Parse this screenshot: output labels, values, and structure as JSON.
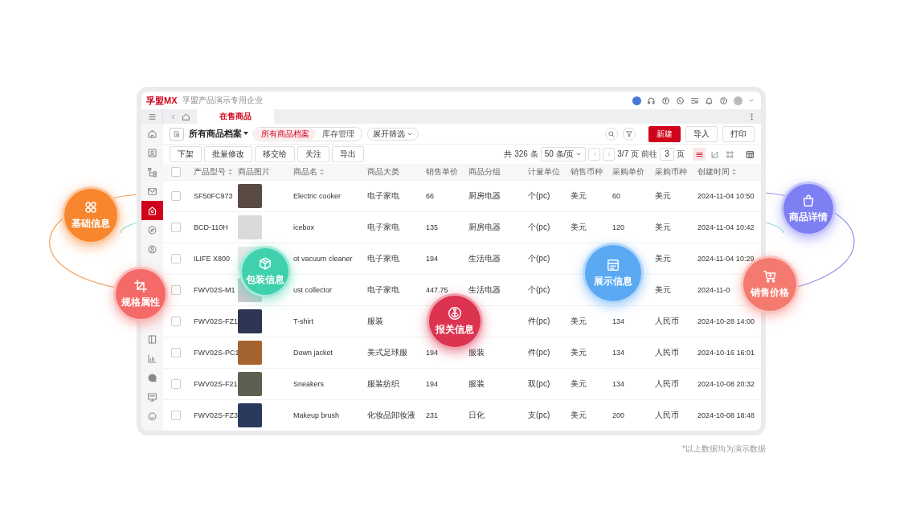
{
  "app": {
    "logo": "孚盟MX",
    "company": "孚盟产品演示专用企业"
  },
  "tabs": [
    {
      "label": "在售商品",
      "selected": true
    }
  ],
  "sidebar": {
    "items": [
      {
        "kind": "home",
        "selected": false
      },
      {
        "kind": "contact",
        "selected": false
      },
      {
        "kind": "org",
        "selected": false
      },
      {
        "kind": "mail",
        "selected": false
      },
      {
        "kind": "store",
        "selected": true
      },
      {
        "kind": "compass",
        "selected": false
      },
      {
        "kind": "user",
        "selected": false
      }
    ],
    "bottom_items": [
      {
        "kind": "book",
        "selected": false
      },
      {
        "kind": "chart",
        "selected": false
      },
      {
        "kind": "chat",
        "selected": false
      },
      {
        "kind": "monitor",
        "selected": false
      },
      {
        "kind": "smile",
        "selected": false
      }
    ]
  },
  "toolbar": {
    "title": "所有商品档案",
    "views": [
      {
        "label": "所有商品档案",
        "selected": true
      },
      {
        "label": "库存管理",
        "selected": false
      }
    ],
    "filter_toggle": "展开筛选",
    "new_button": "新建",
    "import_button": "导入",
    "print_button": "打印"
  },
  "actions": [
    "下架",
    "批量修改",
    "移交给",
    "关注",
    "导出"
  ],
  "pagination": {
    "total": "共 326 条",
    "page_size": "50 条/页",
    "page": "3/7 页",
    "goto_label": "前往",
    "goto_value": "3",
    "goto_unit": "页"
  },
  "view_modes": [
    {
      "kind": "list",
      "selected": true
    },
    {
      "kind": "chart",
      "selected": false
    },
    {
      "kind": "grid",
      "selected": false
    }
  ],
  "table": {
    "select_all": false,
    "columns": [
      {
        "label": "产品型号",
        "sortable": true
      },
      {
        "label": "商品图片",
        "sortable": false
      },
      {
        "label": "商品名",
        "sortable": true
      },
      {
        "label": "商品大类",
        "sortable": false
      },
      {
        "label": "销售单价",
        "sortable": false
      },
      {
        "label": "商品分组",
        "sortable": false
      },
      {
        "label": "计量单位",
        "sortable": false
      },
      {
        "label": "销售币种",
        "sortable": false
      },
      {
        "label": "采购单价",
        "sortable": false
      },
      {
        "label": "采购币种",
        "sortable": false
      },
      {
        "label": "创建时间",
        "sortable": true
      }
    ],
    "rows": [
      {
        "selected": false,
        "model": "SF50FC973",
        "name": "Electric cooker",
        "category": "电子家电",
        "price": "66",
        "group": "厨房电器",
        "unit": "个(pc)",
        "sale_currency": "美元",
        "purchase_price": "60",
        "purchase_currency": "美元",
        "created": "2024-11-04 10:50"
      },
      {
        "selected": false,
        "model": "BCD-110H",
        "name": "icebox",
        "category": "电子家电",
        "price": "135",
        "group": "厨房电器",
        "unit": "个(pc)",
        "sale_currency": "美元",
        "purchase_price": "120",
        "purchase_currency": "美元",
        "created": "2024-11-04 10:42"
      },
      {
        "selected": false,
        "model": "ILIFE X800",
        "name": "ot vacuum cleaner",
        "category": "电子家电",
        "price": "194",
        "group": "生活电器",
        "unit": "个(pc)",
        "purchase_currency": "美元",
        "created": "2024-11-04 10:29"
      },
      {
        "selected": false,
        "model": "FWV02S-M1",
        "name": "ust collector",
        "category": "电子家电",
        "price": "447.75",
        "group": "生活电器",
        "unit": "个(pc)",
        "purchase_currency": "美元",
        "created": "2024-11-0"
      },
      {
        "selected": false,
        "model": "FWV02S-FZ1",
        "name": "T-shirt",
        "category": "服装",
        "unit": "件(pc)",
        "sale_currency": "美元",
        "purchase_price": "134",
        "purchase_currency": "人民币",
        "created": "2024-10-28 14:00"
      },
      {
        "selected": false,
        "model": "FWV02S-PC1",
        "name": "Down jacket",
        "category": "美式足球服",
        "price": "194",
        "group": "服装",
        "unit": "件(pc)",
        "sale_currency": "美元",
        "purchase_price": "134",
        "purchase_currency": "人民币",
        "created": "2024-10-16 16:01"
      },
      {
        "selected": false,
        "model": "FWV02S-F21",
        "name": "Sneakers",
        "category": "服装纺织",
        "price": "194",
        "group": "服装",
        "unit": "双(pc)",
        "sale_currency": "美元",
        "purchase_price": "134",
        "purchase_currency": "人民币",
        "created": "2024-10-08 20:32"
      },
      {
        "selected": false,
        "model": "FWV02S-FZ3",
        "name": "Makeup brush",
        "category": "化妆品卸妆液",
        "price": "231",
        "group": "日化",
        "unit": "支(pc)",
        "sale_currency": "美元",
        "purchase_price": "200",
        "purchase_currency": "人民币",
        "created": "2024-10-08 18:48"
      }
    ]
  },
  "note": "*以上数据均为演示数据",
  "bubbles": [
    {
      "label": "基础信息",
      "color": "#f7862f"
    },
    {
      "label": "商品详情",
      "color": "#7d7ff3"
    },
    {
      "label": "包装信息",
      "color": "#3fd1ad"
    },
    {
      "label": "展示信息",
      "color": "#5aa9f2"
    },
    {
      "label": "规格属性",
      "color": "#f46a68"
    },
    {
      "label": "销售价格",
      "color": "#f47a70"
    },
    {
      "label": "报关信息",
      "color": "#dc3350"
    }
  ]
}
